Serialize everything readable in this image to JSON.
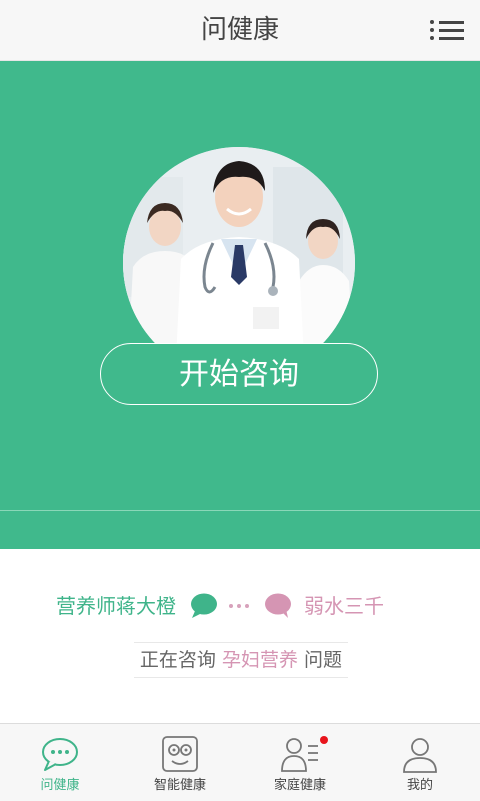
{
  "header": {
    "title": "问健康",
    "menu_icon": "list-menu-icon"
  },
  "hero": {
    "background_color": "#40b98c",
    "image": "doctors-photo",
    "start_button": "开始咨询"
  },
  "chat": {
    "left_name": "营养师蒋大橙",
    "right_name": "弱水三千",
    "left_bubble_color": "#3fb48a",
    "right_bubble_color": "#d595b3"
  },
  "consult": {
    "prefix": "正在咨询",
    "topic": "孕妇营养",
    "suffix": "问题"
  },
  "tabs": [
    {
      "label": "问健康",
      "icon": "chat-bubble-icon",
      "active": true
    },
    {
      "label": "智能健康",
      "icon": "robot-face-icon",
      "active": false
    },
    {
      "label": "家庭健康",
      "icon": "family-list-icon",
      "active": false,
      "badge": true
    },
    {
      "label": "我的",
      "icon": "user-icon",
      "active": false
    }
  ]
}
